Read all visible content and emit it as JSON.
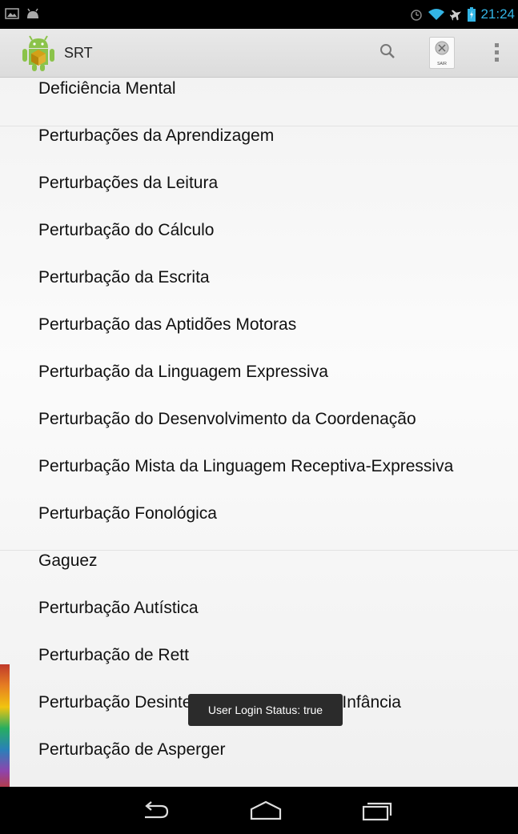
{
  "status_bar": {
    "time": "21:24",
    "left_icons": [
      "image-notification-icon",
      "android-notification-icon"
    ],
    "right_icons": [
      "alarm-icon",
      "wifi-icon",
      "airplane-icon",
      "battery-charging-icon"
    ]
  },
  "action_bar": {
    "title": "SRT",
    "sair_label": "SAIR"
  },
  "list": {
    "items": [
      {
        "label": "Deficiência Mental"
      },
      {
        "label": "Perturbações da Aprendizagem"
      },
      {
        "label": "Perturbações da Leitura"
      },
      {
        "label": "Perturbação do Cálculo"
      },
      {
        "label": "Perturbação da Escrita"
      },
      {
        "label": "Perturbação das Aptidões Motoras"
      },
      {
        "label": "Perturbação da Linguagem Expressiva"
      },
      {
        "label": "Perturbação do Desenvolvimento da Coordenação"
      },
      {
        "label": "Perturbação Mista da Linguagem Receptiva-Expressiva"
      },
      {
        "label": "Perturbação Fonológica"
      },
      {
        "label": "Gaguez"
      },
      {
        "label": "Perturbação Autística"
      },
      {
        "label": "Perturbação de Rett"
      },
      {
        "label": "Perturbação Desintegrativa da Segunda Infância"
      },
      {
        "label": "Perturbação de Asperger"
      }
    ]
  },
  "toast": {
    "text": "User Login Status: true"
  },
  "colors": {
    "status_time": "#33b5e5",
    "action_bar_bg": "#e2e2e2",
    "list_bg": "#f6f6f6",
    "toast_bg": "#2b2b2b"
  }
}
